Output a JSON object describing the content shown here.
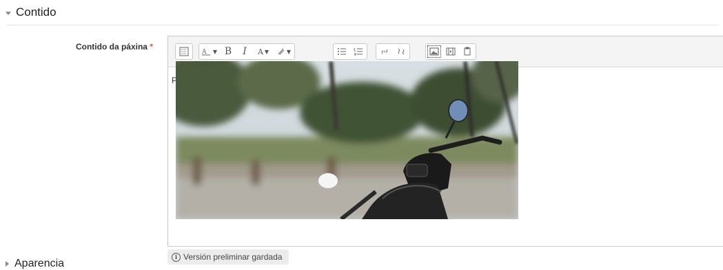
{
  "section": {
    "title": "Contido"
  },
  "field": {
    "label": "Contido da páxina",
    "required_mark": "*"
  },
  "toolbar": {
    "buttons": [
      {
        "icon": "show-more-icon"
      },
      {
        "icon": "font-size-icon"
      },
      {
        "icon": "bold-icon",
        "glyph": "B"
      },
      {
        "icon": "italic-icon",
        "glyph": "I"
      },
      {
        "icon": "font-color-icon",
        "glyph": "A"
      },
      {
        "icon": "background-color-icon"
      },
      {
        "icon": "unordered-list-icon"
      },
      {
        "icon": "ordered-list-icon"
      },
      {
        "icon": "link-icon"
      },
      {
        "icon": "unlink-icon"
      },
      {
        "icon": "image-icon"
      },
      {
        "icon": "media-icon"
      },
      {
        "icon": "manage-files-icon"
      }
    ]
  },
  "editor": {
    "text": "Proba de páxina con imaxe"
  },
  "draft_status": {
    "text": "Versión preliminar gardada"
  },
  "next_section": {
    "title": "Aparencia"
  },
  "colors": {
    "required": "#d9534f",
    "toolbar_bg": "#f4f4f4"
  }
}
